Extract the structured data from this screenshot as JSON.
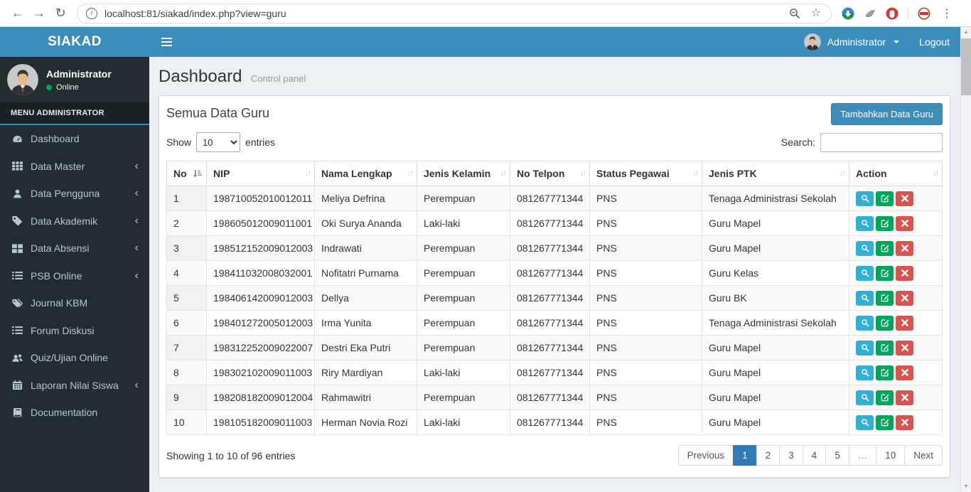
{
  "browser": {
    "url": "localhost:81/siakad/index.php?view=guru"
  },
  "topbar": {
    "brand": "SIAKAD",
    "user_label": "Administrator",
    "logout_label": "Logout"
  },
  "sidebar": {
    "user_name": "Administrator",
    "user_status": "Online",
    "menu_header": "MENU ADMINISTRATOR",
    "items": [
      {
        "label": "Dashboard",
        "icon": "dashboard",
        "submenu": false
      },
      {
        "label": "Data Master",
        "icon": "grid",
        "submenu": true
      },
      {
        "label": "Data Pengguna",
        "icon": "user",
        "submenu": true
      },
      {
        "label": "Data Akademik",
        "icon": "tag",
        "submenu": true
      },
      {
        "label": "Data Absensi",
        "icon": "grid-large",
        "submenu": true
      },
      {
        "label": "PSB Online",
        "icon": "list",
        "submenu": true
      },
      {
        "label": "Journal KBM",
        "icon": "tags",
        "submenu": false
      },
      {
        "label": "Forum Diskusi",
        "icon": "list",
        "submenu": false
      },
      {
        "label": "Quiz/Ujian Online",
        "icon": "users",
        "submenu": false
      },
      {
        "label": "Laporan Nilai Siswa",
        "icon": "calendar",
        "submenu": true
      },
      {
        "label": "Documentation",
        "icon": "book",
        "submenu": false
      }
    ]
  },
  "page": {
    "title": "Dashboard",
    "subtitle": "Control panel"
  },
  "panel": {
    "title": "Semua Data Guru",
    "add_button": "Tambahkan Data Guru",
    "show_label": "Show",
    "page_length": "10",
    "entries_label": "entries",
    "search_label": "Search:",
    "search_value": "",
    "info": "Showing 1 to 10 of 96 entries"
  },
  "table": {
    "columns": [
      "No",
      "NIP",
      "Nama Lengkap",
      "Jenis Kelamin",
      "No Telpon",
      "Status Pegawai",
      "Jenis PTK",
      "Action"
    ],
    "sorted_column": "No",
    "action_icons": [
      "search",
      "edit",
      "delete"
    ],
    "rows": [
      {
        "no": "1",
        "nip": "198710052010012011",
        "nama": "Meliya Defrina",
        "jenis_kelamin": "Perempuan",
        "no_telpon": "081267771344",
        "status_pegawai": "PNS",
        "jenis_ptk": "Tenaga Administrasi Sekolah"
      },
      {
        "no": "2",
        "nip": "198605012009011001",
        "nama": "Oki Surya Ananda",
        "jenis_kelamin": "Laki-laki",
        "no_telpon": "081267771344",
        "status_pegawai": "PNS",
        "jenis_ptk": "Guru Mapel"
      },
      {
        "no": "3",
        "nip": "198512152009012003",
        "nama": "Indrawati",
        "jenis_kelamin": "Perempuan",
        "no_telpon": "081267771344",
        "status_pegawai": "PNS",
        "jenis_ptk": "Guru Mapel"
      },
      {
        "no": "4",
        "nip": "198411032008032001",
        "nama": "Nofitatri Purnama",
        "jenis_kelamin": "Perempuan",
        "no_telpon": "081267771344",
        "status_pegawai": "PNS",
        "jenis_ptk": "Guru Kelas"
      },
      {
        "no": "5",
        "nip": "198406142009012003",
        "nama": "Dellya",
        "jenis_kelamin": "Perempuan",
        "no_telpon": "081267771344",
        "status_pegawai": "PNS",
        "jenis_ptk": "Guru BK"
      },
      {
        "no": "6",
        "nip": "198401272005012003",
        "nama": "Irma Yunita",
        "jenis_kelamin": "Perempuan",
        "no_telpon": "081267771344",
        "status_pegawai": "PNS",
        "jenis_ptk": "Tenaga Administrasi Sekolah"
      },
      {
        "no": "7",
        "nip": "198312252009022007",
        "nama": "Destri Eka Putri",
        "jenis_kelamin": "Perempuan",
        "no_telpon": "081267771344",
        "status_pegawai": "PNS",
        "jenis_ptk": "Guru Mapel"
      },
      {
        "no": "8",
        "nip": "198302102009011003",
        "nama": "Riry Mardiyan",
        "jenis_kelamin": "Laki-laki",
        "no_telpon": "081267771344",
        "status_pegawai": "PNS",
        "jenis_ptk": "Guru Mapel"
      },
      {
        "no": "9",
        "nip": "198208182009012004",
        "nama": "Rahmawitri",
        "jenis_kelamin": "Perempuan",
        "no_telpon": "081267771344",
        "status_pegawai": "PNS",
        "jenis_ptk": "Guru Mapel"
      },
      {
        "no": "10",
        "nip": "198105182009011003",
        "nama": "Herman Novia Rozi",
        "jenis_kelamin": "Laki-laki",
        "no_telpon": "081267771344",
        "status_pegawai": "PNS",
        "jenis_ptk": "Guru Mapel"
      }
    ]
  },
  "pagination": {
    "items": [
      "Previous",
      "1",
      "2",
      "3",
      "4",
      "5",
      "…",
      "10",
      "Next"
    ],
    "active": "1"
  },
  "colors": {
    "accent": "#3c8dbc",
    "sidebar_bg": "#222d32",
    "content_bg": "#ecf0f5",
    "view_button": "#31b0d5",
    "edit_button": "#00a65a",
    "delete_button": "#d9534f",
    "pagination_active": "#337ab7",
    "online_dot": "#00a65a"
  }
}
